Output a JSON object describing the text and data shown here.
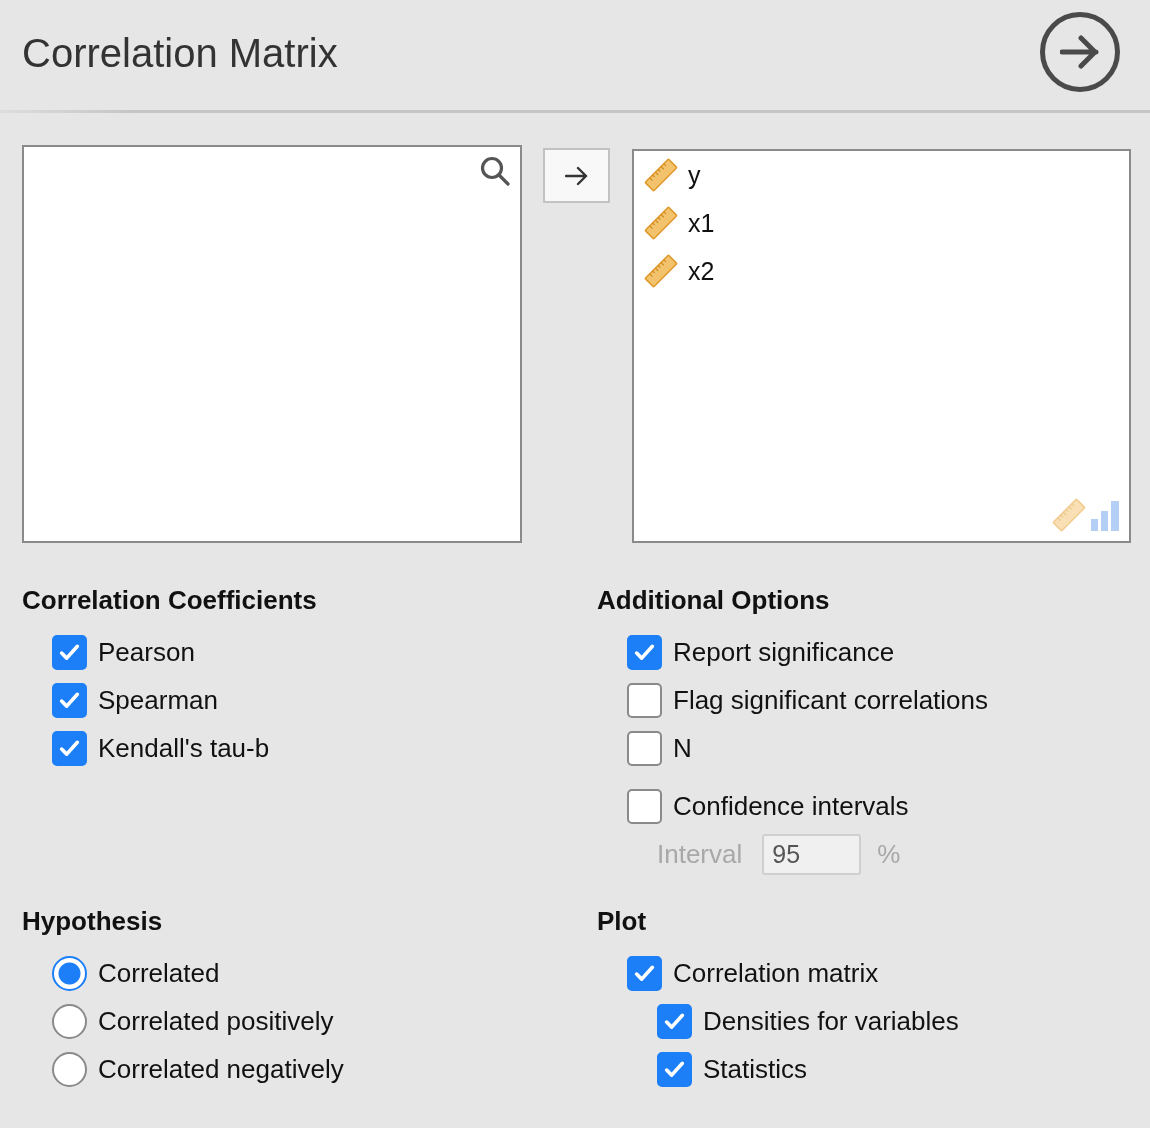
{
  "header": {
    "title": "Correlation Matrix"
  },
  "target_list": {
    "items": [
      {
        "name": "y"
      },
      {
        "name": "x1"
      },
      {
        "name": "x2"
      }
    ]
  },
  "sections": [
    {
      "title": "Correlation Coefficients",
      "options": [
        {
          "kind": "checkbox",
          "label": "Pearson",
          "checked": true
        },
        {
          "kind": "checkbox",
          "label": "Spearman",
          "checked": true
        },
        {
          "kind": "checkbox",
          "label": "Kendall's tau-b",
          "checked": true
        }
      ]
    },
    {
      "title": "Additional Options",
      "options": [
        {
          "kind": "checkbox",
          "label": "Report significance",
          "checked": true
        },
        {
          "kind": "checkbox",
          "label": "Flag significant correlations",
          "checked": false
        },
        {
          "kind": "checkbox",
          "label": "N",
          "checked": false
        },
        {
          "kind": "checkbox",
          "label": "Confidence intervals",
          "checked": false,
          "children": [
            {
              "kind": "number",
              "label": "Interval",
              "value": "95",
              "suffix": "%"
            }
          ]
        }
      ]
    },
    {
      "title": "Hypothesis",
      "options": [
        {
          "kind": "radio",
          "label": "Correlated",
          "selected": true
        },
        {
          "kind": "radio",
          "label": "Correlated positively",
          "selected": false
        },
        {
          "kind": "radio",
          "label": "Correlated negatively",
          "selected": false
        }
      ]
    },
    {
      "title": "Plot",
      "options": [
        {
          "kind": "checkbox",
          "label": "Correlation matrix",
          "checked": true,
          "children": [
            {
              "kind": "checkbox",
              "label": "Densities for variables",
              "checked": true
            },
            {
              "kind": "checkbox",
              "label": "Statistics",
              "checked": true
            }
          ]
        }
      ]
    }
  ]
}
